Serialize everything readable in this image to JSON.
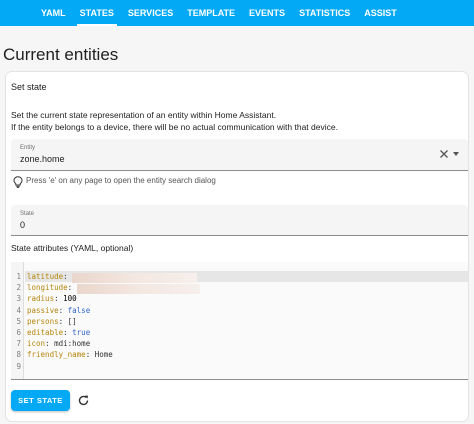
{
  "tabs": [
    "YAML",
    "STATES",
    "SERVICES",
    "TEMPLATE",
    "EVENTS",
    "STATISTICS",
    "ASSIST"
  ],
  "active_tab": "STATES",
  "page_title": "Current entities",
  "card": {
    "title": "Set state",
    "description_line1": "Set the current state representation of an entity within Home Assistant.",
    "description_line2": "If the entity belongs to a device, there will be no actual communication with that device.",
    "entity_field": {
      "label": "Entity",
      "value": "zone.home"
    },
    "hint": "Press 'e' on any page to open the entity search dialog",
    "state_field": {
      "label": "State",
      "value": "0"
    },
    "attributes_label": "State attributes (YAML, optional)",
    "editor_lines": [
      {
        "num": "1",
        "key": "latitude",
        "value": "",
        "type": "redacted"
      },
      {
        "num": "2",
        "key": "longitude",
        "value": "",
        "type": "redacted"
      },
      {
        "num": "3",
        "key": "radius",
        "value": "100",
        "type": "num"
      },
      {
        "num": "4",
        "key": "passive",
        "value": "false",
        "type": "bool"
      },
      {
        "num": "5",
        "key": "persons",
        "value": "[]",
        "type": "str"
      },
      {
        "num": "6",
        "key": "editable",
        "value": "true",
        "type": "bool"
      },
      {
        "num": "7",
        "key": "icon",
        "value": "mdi:home",
        "type": "str"
      },
      {
        "num": "8",
        "key": "friendly_name",
        "value": "Home",
        "type": "str"
      },
      {
        "num": "9",
        "key": "",
        "value": "",
        "type": "empty"
      }
    ],
    "set_state_button": "SET STATE"
  },
  "colors": {
    "accent": "#03a9f4",
    "yaml_key": "#b8860b",
    "yaml_bool": "#3366cc"
  },
  "icons": {
    "clear": "close-icon",
    "dropdown": "menu-down-icon",
    "hint": "lightbulb-icon",
    "refresh": "refresh-icon"
  }
}
